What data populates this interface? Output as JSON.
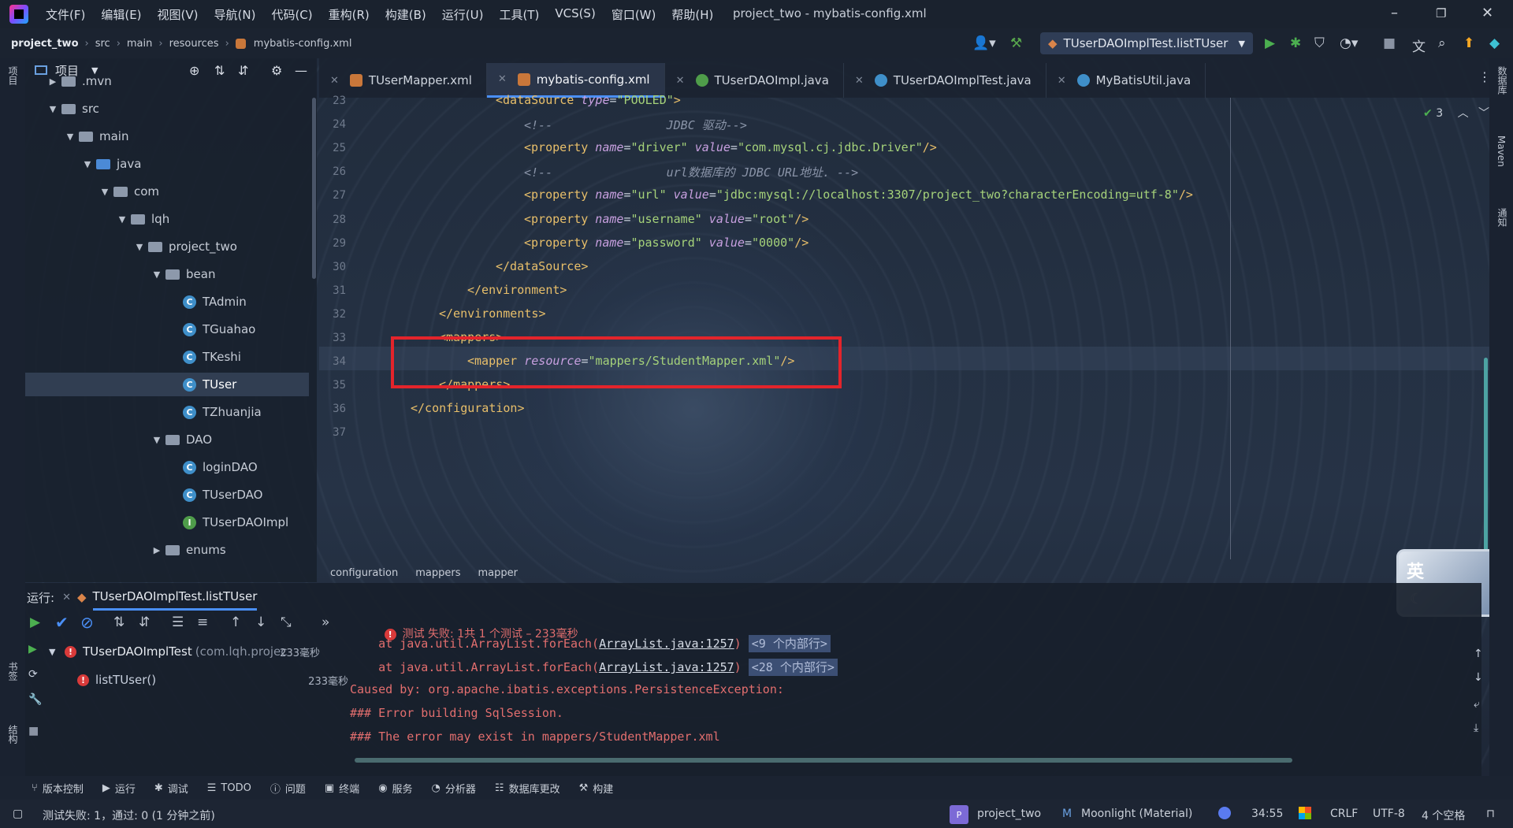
{
  "titlebar": {
    "menus": [
      "文件(F)",
      "编辑(E)",
      "视图(V)",
      "导航(N)",
      "代码(C)",
      "重构(R)",
      "构建(B)",
      "运行(U)",
      "工具(T)",
      "VCS(S)",
      "窗口(W)",
      "帮助(H)"
    ],
    "title": "project_two - mybatis-config.xml"
  },
  "nav": {
    "crumbs": [
      "project_two",
      "src",
      "main",
      "resources",
      "mybatis-config.xml"
    ],
    "run_config": "TUserDAOImplTest.listTUser"
  },
  "left_strip": {
    "project": "项目",
    "bookmarks": "书签",
    "structure": "结构"
  },
  "project": {
    "title": "项目",
    "tree": [
      {
        "label": ".mvn",
        "type": "folder"
      },
      {
        "label": "src",
        "type": "folder"
      },
      {
        "label": "main",
        "type": "folder"
      },
      {
        "label": "java",
        "type": "folder-blue"
      },
      {
        "label": "com",
        "type": "package"
      },
      {
        "label": "lqh",
        "type": "package"
      },
      {
        "label": "project_two",
        "type": "package"
      },
      {
        "label": "bean",
        "type": "package"
      },
      {
        "label": "TAdmin",
        "type": "class"
      },
      {
        "label": "TGuahao",
        "type": "class"
      },
      {
        "label": "TKeshi",
        "type": "class"
      },
      {
        "label": "TUser",
        "type": "class"
      },
      {
        "label": "TZhuanjia",
        "type": "class"
      },
      {
        "label": "DAO",
        "type": "package"
      },
      {
        "label": "loginDAO",
        "type": "class"
      },
      {
        "label": "TUserDAO",
        "type": "class"
      },
      {
        "label": "TUserDAOImpl",
        "type": "interface"
      },
      {
        "label": "enums",
        "type": "package"
      }
    ]
  },
  "tabs": [
    {
      "label": "TUserMapper.xml",
      "icon": "xml"
    },
    {
      "label": "mybatis-config.xml",
      "icon": "xml",
      "active": true
    },
    {
      "label": "TUserDAOImpl.java",
      "icon": "java-interface"
    },
    {
      "label": "TUserDAOImplTest.java",
      "icon": "java-class"
    },
    {
      "label": "MyBatisUtil.java",
      "icon": "java-class"
    }
  ],
  "editor": {
    "inspection_count": "3",
    "lines": [
      {
        "n": "23",
        "text": "<dataSource type=\"POOLED\">"
      },
      {
        "n": "24",
        "text": "<!--                JDBC 驱动-->"
      },
      {
        "n": "25",
        "text": "<property name=\"driver\" value=\"com.mysql.cj.jdbc.Driver\"/>"
      },
      {
        "n": "26",
        "text": "<!--                url数据库的 JDBC URL地址. -->"
      },
      {
        "n": "27",
        "text": "<property name=\"url\" value=\"jdbc:mysql://localhost:3307/project_two?characterEncoding=utf-8\"/>"
      },
      {
        "n": "28",
        "text": "<property name=\"username\" value=\"root\"/>"
      },
      {
        "n": "29",
        "text": "<property name=\"password\" value=\"0000\"/>"
      },
      {
        "n": "30",
        "text": "</dataSource>"
      },
      {
        "n": "31",
        "text": "</environment>"
      },
      {
        "n": "32",
        "text": "</environments>"
      },
      {
        "n": "33",
        "text": "<mappers>"
      },
      {
        "n": "34",
        "text": "<mapper resource=\"mappers/StudentMapper.xml\"/>"
      },
      {
        "n": "35",
        "text": "</mappers>"
      },
      {
        "n": "36",
        "text": "</configuration>"
      },
      {
        "n": "37",
        "text": ""
      }
    ],
    "breadcrumb": [
      "configuration",
      "mappers",
      "mapper"
    ]
  },
  "run": {
    "label": "运行:",
    "config": "TUserDAOImplTest.listTUser",
    "status": "测试 失败: 1共 1 个测试 – 233毫秒",
    "tree": [
      {
        "label": "TUserDAOImplTest",
        "detail": "(com.lqh.projec",
        "time": "233毫秒"
      },
      {
        "label": "listTUser()",
        "time": "233毫秒"
      }
    ],
    "console": {
      "l1_prefix": "    at java.util.ArrayList.forEach(",
      "l1_link": "ArrayList.java:1257",
      "l1_suffix": ")",
      "l1_fold": "<9 个内部行>",
      "l2_prefix": "    at java.util.ArrayList.forEach(",
      "l2_link": "ArrayList.java:1257",
      "l2_suffix": ")",
      "l2_fold": "<28 个内部行>",
      "l3": "Caused by: org.apache.ibatis.exceptions.PersistenceException:",
      "l4": "### Error building SqlSession.",
      "l5": "### The error may exist in mappers/StudentMapper.xml"
    }
  },
  "right_strip": {
    "database": "数据库",
    "maven": "Maven",
    "notifications": "通知"
  },
  "tool_tabs": [
    "版本控制",
    "运行",
    "调试",
    "TODO",
    "问题",
    "终端",
    "服务",
    "分析器",
    "数据库更改",
    "构建"
  ],
  "status": {
    "message": "测试失败: 1，通过: 0 (1 分钟之前)",
    "project": "project_two",
    "theme": "Moonlight (Material)",
    "position": "34:55",
    "line_ending": "CRLF",
    "encoding": "UTF-8",
    "indent": "4 个空格"
  },
  "ime": {
    "label": "英"
  },
  "colors": {
    "accent": "#4a8ff7",
    "error": "#e3242b",
    "tag": "#e8bf6a",
    "value": "#a5d27a"
  }
}
